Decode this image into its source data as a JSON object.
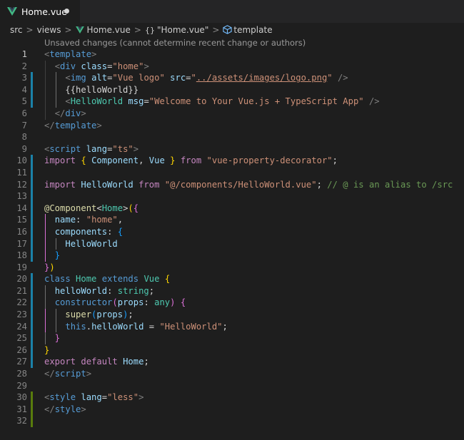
{
  "tab": {
    "label": "Home.vue",
    "logo_icon": "vue-logo-icon",
    "dirty_icon": "unsaved-dot-icon"
  },
  "breadcrumb": {
    "items": [
      "src",
      "views",
      "Home.vue",
      "\"Home.vue\"",
      "template"
    ],
    "separator": ">"
  },
  "codelens": "Unsaved changes (cannot determine recent change or authors)",
  "editor": {
    "current_line": 1,
    "lines": [
      {
        "n": "1",
        "gutter": "",
        "tokens": [
          [
            "t-br",
            "<"
          ],
          [
            "t-tag",
            "template"
          ],
          [
            "t-br",
            ">"
          ]
        ]
      },
      {
        "n": "2",
        "gutter": "",
        "tokens": [
          [
            "t-pl",
            "  "
          ],
          [
            "t-br",
            "<"
          ],
          [
            "t-tag",
            "div"
          ],
          [
            "t-pl",
            " "
          ],
          [
            "t-attr",
            "class"
          ],
          [
            "t-pl",
            "="
          ],
          [
            "t-str",
            "\"home\""
          ],
          [
            "t-br",
            ">"
          ]
        ]
      },
      {
        "n": "3",
        "gutter": "blue",
        "tokens": [
          [
            "t-pl",
            "    "
          ],
          [
            "t-br",
            "<"
          ],
          [
            "t-tag",
            "img"
          ],
          [
            "t-pl",
            " "
          ],
          [
            "t-attr",
            "alt"
          ],
          [
            "t-pl",
            "="
          ],
          [
            "t-str",
            "\"Vue logo\""
          ],
          [
            "t-pl",
            " "
          ],
          [
            "t-attr",
            "src"
          ],
          [
            "t-pl",
            "="
          ],
          [
            "t-str",
            "\""
          ],
          [
            "t-link",
            "../assets/images/logo.png"
          ],
          [
            "t-str",
            "\""
          ],
          [
            "t-pl",
            " "
          ],
          [
            "t-br",
            "/>"
          ]
        ]
      },
      {
        "n": "4",
        "gutter": "blue",
        "tokens": [
          [
            "t-pl",
            "    {{helloWorld}}"
          ]
        ]
      },
      {
        "n": "5",
        "gutter": "blue",
        "tokens": [
          [
            "t-pl",
            "    "
          ],
          [
            "t-br",
            "<"
          ],
          [
            "t-type",
            "HelloWorld"
          ],
          [
            "t-pl",
            " "
          ],
          [
            "t-attr",
            "msg"
          ],
          [
            "t-pl",
            "="
          ],
          [
            "t-str",
            "\"Welcome to Your Vue.js + TypeScript App\""
          ],
          [
            "t-pl",
            " "
          ],
          [
            "t-br",
            "/>"
          ]
        ]
      },
      {
        "n": "6",
        "gutter": "",
        "tokens": [
          [
            "t-pl",
            "  "
          ],
          [
            "t-br",
            "</"
          ],
          [
            "t-tag",
            "div"
          ],
          [
            "t-br",
            ">"
          ]
        ]
      },
      {
        "n": "7",
        "gutter": "",
        "tokens": [
          [
            "t-br",
            "</"
          ],
          [
            "t-tag",
            "template"
          ],
          [
            "t-br",
            ">"
          ]
        ]
      },
      {
        "n": "8",
        "gutter": "",
        "tokens": []
      },
      {
        "n": "9",
        "gutter": "",
        "tokens": [
          [
            "t-br",
            "<"
          ],
          [
            "t-tag",
            "script"
          ],
          [
            "t-pl",
            " "
          ],
          [
            "t-attr",
            "lang"
          ],
          [
            "t-pl",
            "="
          ],
          [
            "t-str",
            "\"ts\""
          ],
          [
            "t-br",
            ">"
          ]
        ]
      },
      {
        "n": "10",
        "gutter": "blue",
        "tokens": [
          [
            "t-kw",
            "import"
          ],
          [
            "t-pl",
            " "
          ],
          [
            "t-b1",
            "{"
          ],
          [
            "t-pl",
            " "
          ],
          [
            "t-var",
            "Component"
          ],
          [
            "t-pl",
            ", "
          ],
          [
            "t-var",
            "Vue"
          ],
          [
            "t-pl",
            " "
          ],
          [
            "t-b1",
            "}"
          ],
          [
            "t-pl",
            " "
          ],
          [
            "t-kw",
            "from"
          ],
          [
            "t-pl",
            " "
          ],
          [
            "t-str",
            "\"vue-property-decorator\""
          ],
          [
            "t-pl",
            ";"
          ]
        ]
      },
      {
        "n": "11",
        "gutter": "blue",
        "tokens": []
      },
      {
        "n": "12",
        "gutter": "blue",
        "tokens": [
          [
            "t-kw",
            "import"
          ],
          [
            "t-pl",
            " "
          ],
          [
            "t-var",
            "HelloWorld"
          ],
          [
            "t-pl",
            " "
          ],
          [
            "t-kw",
            "from"
          ],
          [
            "t-pl",
            " "
          ],
          [
            "t-str",
            "\"@/components/HelloWorld.vue\""
          ],
          [
            "t-pl",
            "; "
          ],
          [
            "t-cmt",
            "// @ is an alias to /src"
          ]
        ]
      },
      {
        "n": "13",
        "gutter": "blue",
        "tokens": []
      },
      {
        "n": "14",
        "gutter": "blue",
        "tokens": [
          [
            "t-fn",
            "@Component"
          ],
          [
            "t-pl",
            "<"
          ],
          [
            "t-type",
            "Home"
          ],
          [
            "t-pl",
            ">"
          ],
          [
            "t-b1",
            "("
          ],
          [
            "t-b2",
            "{"
          ]
        ]
      },
      {
        "n": "15",
        "gutter": "blue",
        "tokens": [
          [
            "t-pl",
            "  "
          ],
          [
            "t-var",
            "name"
          ],
          [
            "t-pl",
            ": "
          ],
          [
            "t-str",
            "\"home\""
          ],
          [
            "t-pl",
            ","
          ]
        ]
      },
      {
        "n": "16",
        "gutter": "blue",
        "tokens": [
          [
            "t-pl",
            "  "
          ],
          [
            "t-var",
            "components"
          ],
          [
            "t-pl",
            ": "
          ],
          [
            "t-b3",
            "{"
          ]
        ]
      },
      {
        "n": "17",
        "gutter": "blue",
        "tokens": [
          [
            "t-pl",
            "    "
          ],
          [
            "t-var",
            "HelloWorld"
          ]
        ]
      },
      {
        "n": "18",
        "gutter": "blue",
        "tokens": [
          [
            "t-pl",
            "  "
          ],
          [
            "t-b3",
            "}"
          ]
        ]
      },
      {
        "n": "19",
        "gutter": "",
        "tokens": [
          [
            "t-b2",
            "}"
          ],
          [
            "t-b1",
            ")"
          ]
        ]
      },
      {
        "n": "20",
        "gutter": "blue",
        "tokens": [
          [
            "t-kwb",
            "class"
          ],
          [
            "t-pl",
            " "
          ],
          [
            "t-type",
            "Home"
          ],
          [
            "t-pl",
            " "
          ],
          [
            "t-kwb",
            "extends"
          ],
          [
            "t-pl",
            " "
          ],
          [
            "t-type",
            "Vue"
          ],
          [
            "t-pl",
            " "
          ],
          [
            "t-b1",
            "{"
          ]
        ]
      },
      {
        "n": "21",
        "gutter": "blue",
        "tokens": [
          [
            "t-pl",
            "  "
          ],
          [
            "t-var",
            "helloWorld"
          ],
          [
            "t-pl",
            ": "
          ],
          [
            "t-type",
            "string"
          ],
          [
            "t-pl",
            ";"
          ]
        ]
      },
      {
        "n": "22",
        "gutter": "blue",
        "tokens": [
          [
            "t-pl",
            "  "
          ],
          [
            "t-kwb",
            "constructor"
          ],
          [
            "t-b2",
            "("
          ],
          [
            "t-var",
            "props"
          ],
          [
            "t-pl",
            ": "
          ],
          [
            "t-type",
            "any"
          ],
          [
            "t-b2",
            ")"
          ],
          [
            "t-pl",
            " "
          ],
          [
            "t-b2",
            "{"
          ]
        ]
      },
      {
        "n": "23",
        "gutter": "blue",
        "tokens": [
          [
            "t-pl",
            "    "
          ],
          [
            "t-fn",
            "super"
          ],
          [
            "t-b3",
            "("
          ],
          [
            "t-var",
            "props"
          ],
          [
            "t-b3",
            ")"
          ],
          [
            "t-pl",
            ";"
          ]
        ]
      },
      {
        "n": "24",
        "gutter": "blue",
        "tokens": [
          [
            "t-pl",
            "    "
          ],
          [
            "t-kwb",
            "this"
          ],
          [
            "t-pl",
            "."
          ],
          [
            "t-var",
            "helloWorld"
          ],
          [
            "t-pl",
            " = "
          ],
          [
            "t-str",
            "\"HelloWorld\""
          ],
          [
            "t-pl",
            ";"
          ]
        ]
      },
      {
        "n": "25",
        "gutter": "blue",
        "tokens": [
          [
            "t-pl",
            "  "
          ],
          [
            "t-b2",
            "}"
          ]
        ]
      },
      {
        "n": "26",
        "gutter": "blue",
        "tokens": [
          [
            "t-b1",
            "}"
          ]
        ]
      },
      {
        "n": "27",
        "gutter": "blue",
        "tokens": [
          [
            "t-kw",
            "export"
          ],
          [
            "t-pl",
            " "
          ],
          [
            "t-kw",
            "default"
          ],
          [
            "t-pl",
            " "
          ],
          [
            "t-var",
            "Home"
          ],
          [
            "t-pl",
            ";"
          ]
        ]
      },
      {
        "n": "28",
        "gutter": "",
        "tokens": [
          [
            "t-br",
            "</"
          ],
          [
            "t-tag",
            "script"
          ],
          [
            "t-br",
            ">"
          ]
        ]
      },
      {
        "n": "29",
        "gutter": "",
        "tokens": []
      },
      {
        "n": "30",
        "gutter": "green",
        "tokens": [
          [
            "t-br",
            "<"
          ],
          [
            "t-tag",
            "style"
          ],
          [
            "t-pl",
            " "
          ],
          [
            "t-attr",
            "lang"
          ],
          [
            "t-pl",
            "="
          ],
          [
            "t-str",
            "\"less\""
          ],
          [
            "t-br",
            ">"
          ]
        ]
      },
      {
        "n": "31",
        "gutter": "green",
        "tokens": [
          [
            "t-br",
            "</"
          ],
          [
            "t-tag",
            "style"
          ],
          [
            "t-br",
            ">"
          ]
        ]
      },
      {
        "n": "32",
        "gutter": "green",
        "tokens": []
      }
    ]
  },
  "colors": {
    "background": "#1e1e1e",
    "tab_bar": "#252526",
    "modified_gutter": "#1b81a8",
    "added_gutter": "#587c0c",
    "vue_logo": "#41b883"
  }
}
